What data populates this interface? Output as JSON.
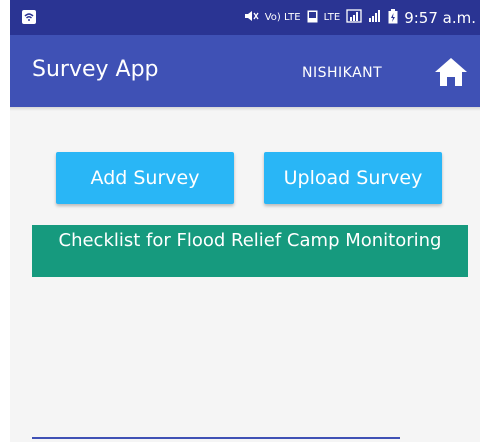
{
  "status_bar": {
    "indicators": [
      "Vo) LTE",
      "LTE"
    ],
    "time": "9:57 a.m."
  },
  "app_bar": {
    "title": "Survey App",
    "user": "NISHIKANT",
    "home_icon": "home-icon"
  },
  "actions": {
    "add_survey": "Add Survey",
    "upload_survey": "Upload Survey"
  },
  "surveys": [
    {
      "title": "Checklist for Flood Relief Camp Monitoring"
    }
  ],
  "colors": {
    "status_bar": "#2a3493",
    "app_bar": "#3f51b5",
    "button": "#29b6f6",
    "survey_card": "#169a7e"
  }
}
